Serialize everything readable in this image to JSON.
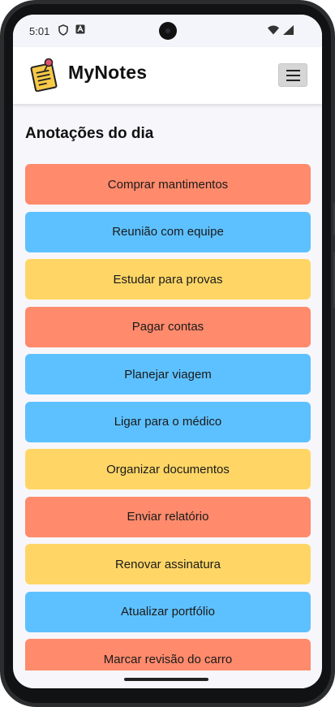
{
  "status_bar": {
    "time": "5:01",
    "icons_left": [
      "shield-icon",
      "font-a-icon"
    ],
    "icons_right": [
      "wifi-icon",
      "battery-icon"
    ]
  },
  "header": {
    "title": "MyNotes",
    "logo_icon": "notepad-pin-icon",
    "menu_icon": "hamburger-icon"
  },
  "section": {
    "title": "Anotações do dia"
  },
  "colors": {
    "red": "#ff8a6c",
    "blue": "#5ec1ff",
    "yellow": "#ffd666"
  },
  "notes": [
    {
      "label": "Comprar mantimentos",
      "color": "red"
    },
    {
      "label": "Reunião com equipe",
      "color": "blue"
    },
    {
      "label": "Estudar para provas",
      "color": "yellow"
    },
    {
      "label": "Pagar contas",
      "color": "red"
    },
    {
      "label": "Planejar viagem",
      "color": "blue"
    },
    {
      "label": "Ligar para o médico",
      "color": "blue"
    },
    {
      "label": "Organizar documentos",
      "color": "yellow"
    },
    {
      "label": "Enviar relatório",
      "color": "red"
    },
    {
      "label": "Renovar assinatura",
      "color": "yellow"
    },
    {
      "label": "Atualizar portfólio",
      "color": "blue"
    },
    {
      "label": "Marcar revisão do carro",
      "color": "red"
    }
  ]
}
